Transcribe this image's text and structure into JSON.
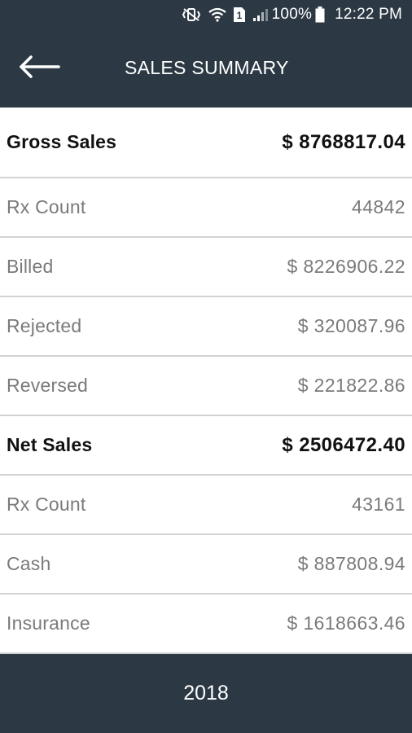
{
  "status_bar": {
    "battery_text": "100%",
    "time": "12:22 PM",
    "icons": [
      "mute-vibrate-icon",
      "wifi-icon",
      "sim-1-icon",
      "signal-icon",
      "battery-icon"
    ]
  },
  "app_bar": {
    "title": "SALES SUMMARY",
    "back_icon": "arrow-left-icon"
  },
  "rows": [
    {
      "label": "Gross Sales",
      "value": "$ 8768817.04",
      "emphasis": true
    },
    {
      "label": "Rx Count",
      "value": "44842",
      "emphasis": false
    },
    {
      "label": "Billed",
      "value": "$ 8226906.22",
      "emphasis": false
    },
    {
      "label": "Rejected",
      "value": "$ 320087.96",
      "emphasis": false
    },
    {
      "label": "Reversed",
      "value": "$ 221822.86",
      "emphasis": false
    },
    {
      "label": "Net Sales",
      "value": "$ 2506472.40",
      "emphasis": true
    },
    {
      "label": "Rx Count",
      "value": "43161",
      "emphasis": false
    },
    {
      "label": "Cash",
      "value": "$ 887808.94",
      "emphasis": false
    },
    {
      "label": "Insurance",
      "value": "$ 1618663.46",
      "emphasis": false
    }
  ],
  "footer": {
    "year": "2018"
  },
  "colors": {
    "bar_background": "#2c3944",
    "divider": "#d3d3d3",
    "muted_text": "#7a7a7a",
    "strong_text": "#111111"
  }
}
